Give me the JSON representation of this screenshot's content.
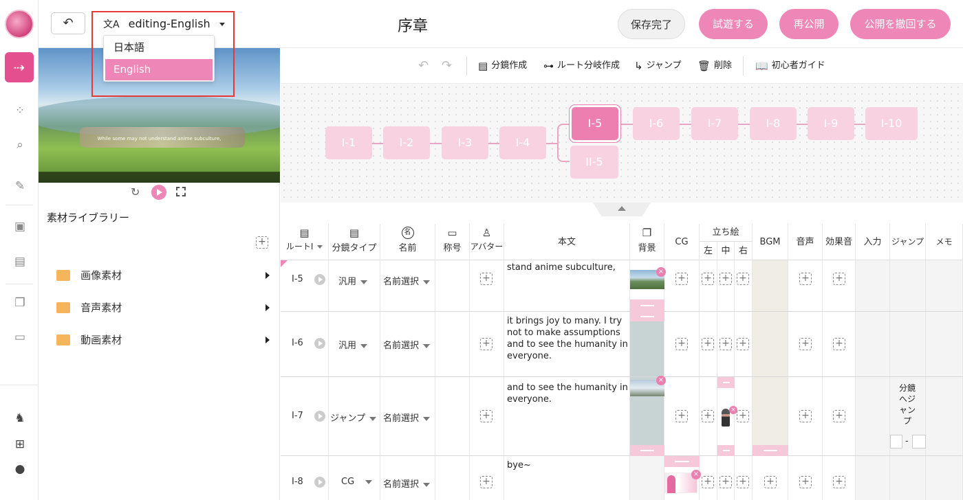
{
  "topbar": {
    "back_label": "↶",
    "lang_selector": "editing-English",
    "title": "序章",
    "save_done": "保存完了",
    "trial_play": "試遊する",
    "republish": "再公開",
    "unpublish": "公開を撤回する"
  },
  "lang_dropdown": {
    "options": [
      "日本語",
      "English"
    ],
    "selected": "English"
  },
  "preview": {
    "subtitle": "While some may not understand anime subculture,"
  },
  "library": {
    "title": "素材ライブラリー",
    "folders": [
      "画像素材",
      "音声素材",
      "動画素材"
    ]
  },
  "toolbar": {
    "storyboard": "分鏡作成",
    "route_branch": "ルート分岐作成",
    "jump": "ジャンプ",
    "delete": "削除",
    "guide": "初心者ガイド"
  },
  "graph": {
    "nodes": [
      "I-1",
      "I-2",
      "I-3",
      "I-4",
      "I-5",
      "I-6",
      "I-7",
      "I-8",
      "I-9",
      "I-10"
    ],
    "branch_node": "II-5",
    "active": "I-5"
  },
  "table": {
    "headers": {
      "route": "ルートⅠ",
      "type": "分鏡タイプ",
      "name": "名前",
      "title": "称号",
      "avatar": "アバター",
      "body": "本文",
      "bg": "背景",
      "cg": "CG",
      "standing": "立ち絵",
      "left": "左",
      "center": "中",
      "right": "右",
      "bgm": "BGM",
      "voice": "音声",
      "se": "効果音",
      "input": "入力",
      "jump": "ジャンプ",
      "memo": "メモ"
    },
    "rows": [
      {
        "id": "I-5",
        "type": "汎用",
        "name": "名前選択",
        "text": "stand anime subculture,"
      },
      {
        "id": "I-6",
        "type": "汎用",
        "name": "名前選択",
        "text": "it brings joy to many. I try not to make assumptions and to see the humanity in everyone."
      },
      {
        "id": "I-7",
        "type": "ジャンプ",
        "name": "名前選択",
        "text": "and to see the humanity in everyone.",
        "jump_label": "分鏡へジャンプ",
        "jump_sep": "-"
      },
      {
        "id": "I-8",
        "type": "CG",
        "name": "名前選択",
        "text": "bye~"
      }
    ]
  },
  "colors": {
    "accent": "#ee86b7",
    "highlight": "#e53935"
  }
}
